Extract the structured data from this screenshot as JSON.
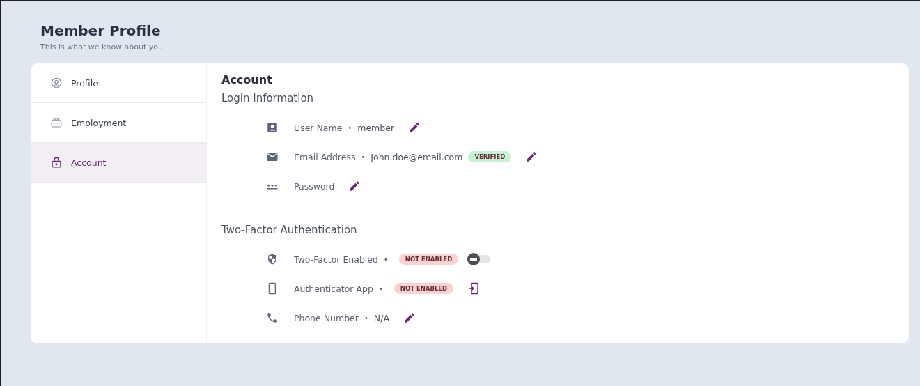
{
  "header": {
    "title": "Member Profile",
    "subtitle": "This is what we know about you"
  },
  "sidebar": {
    "items": [
      {
        "label": "Profile",
        "selected": false
      },
      {
        "label": "Employment",
        "selected": false
      },
      {
        "label": "Account",
        "selected": true
      }
    ]
  },
  "content": {
    "title": "Account",
    "sections": [
      {
        "title": "Login Information",
        "rows": [
          {
            "kind": "edit",
            "label": "User Name",
            "separator": "•",
            "value": "member"
          },
          {
            "kind": "edit",
            "label": "Email Address",
            "separator": "•",
            "value": "John.doe@email.com",
            "badge": {
              "text": "VERIFIED",
              "color": "#c6f2d4"
            }
          },
          {
            "kind": "edit",
            "label": "Password"
          }
        ]
      },
      {
        "title": "Two-Factor Authentication",
        "rows": [
          {
            "kind": "toggle",
            "label": "Two-Factor Enabled",
            "separator": "•",
            "badge": {
              "text": "NOT ENABLED",
              "color": "#fbd2d2"
            },
            "on": false
          },
          {
            "kind": "link",
            "label": "Authenticator App",
            "separator": "•",
            "badge": {
              "text": "NOT ENABLED",
              "color": "#fbd2d2"
            }
          },
          {
            "kind": "edit",
            "label": "Phone Number",
            "separator": "•",
            "value": "N/A"
          }
        ]
      }
    ]
  }
}
